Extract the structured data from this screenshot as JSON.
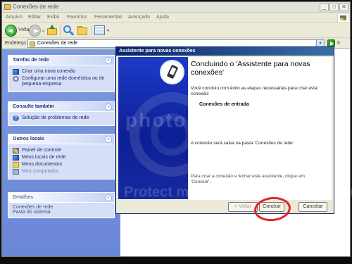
{
  "window": {
    "title": "Conexões de rede",
    "buttons": [
      "_",
      "□",
      "✕"
    ]
  },
  "menubar": {
    "items": [
      "Arquivo",
      "Editar",
      "Exibir",
      "Favoritos",
      "Ferramentas",
      "Avançado",
      "Ajuda"
    ]
  },
  "toolbar": {
    "back_label": "Voltar"
  },
  "address": {
    "label": "Endereço",
    "value": "Conexões de rede",
    "go_label": "Ir"
  },
  "tasks": {
    "title": "Tarefas de rede",
    "items": [
      "Criar uma nova conexão",
      "Configurar uma rede doméstica ou de pequena empresa"
    ]
  },
  "see_also": {
    "title": "Consulte também",
    "items": [
      "Solução de problemas de rede"
    ]
  },
  "other_places": {
    "title": "Outros locais",
    "items": [
      "Painel de controle",
      "Meus locais de rede",
      "Meus documentos",
      "Meu computador"
    ]
  },
  "details": {
    "title": "Detalhes",
    "name": "Conexões de rede",
    "subtitle": "Pasta do sistema"
  },
  "wizard": {
    "title": "Assistente para novas conexões",
    "heading": "Concluindo o 'Assistente para novas conexões'",
    "intro": "Você concluiu com êxito as etapas necessárias para criar esta conexão:",
    "connection": "Conexões de entrada",
    "saved_note": "A conexão será salva na pasta 'Conexões de rede'.",
    "finish_note": "Para criar a conexão e fechar este assistente, clique em 'Concluir'.",
    "back_button": "< Voltar",
    "finish_button": "Concluir",
    "cancel_button": "Cancelar"
  },
  "watermark": {
    "line1": "photo",
    "line2": "Protect more of your memories for less!"
  }
}
